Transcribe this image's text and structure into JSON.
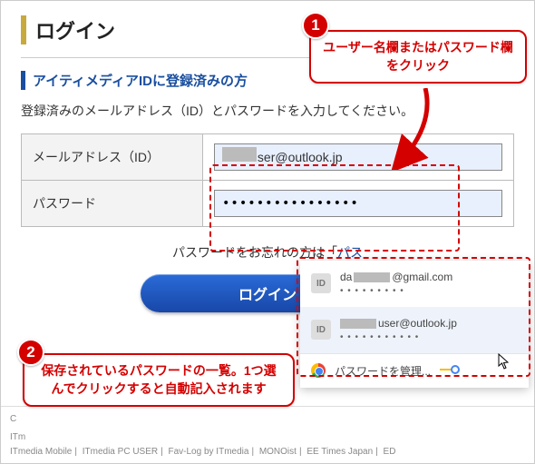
{
  "header": {
    "title": "ログイン",
    "subtitle": "アイティメディアIDに登録済みの方",
    "instruction": "登録済みのメールアドレス（ID）とパスワードを入力してください。"
  },
  "form": {
    "email_label": "メールアドレス（ID）",
    "email_value": "        user@outlook.jp",
    "password_label": "パスワード",
    "password_value": "••••••••••••••••"
  },
  "forgot": {
    "prefix": "パスワードをお忘れの方は「",
    "link": "パス"
  },
  "login_button": "ログイン",
  "autofill": {
    "items": [
      {
        "prefix": "da",
        "suffix": "@gmail.com",
        "dots": "• • • • • • • • •"
      },
      {
        "prefix": "",
        "suffix": "user@outlook.jp",
        "dots": "• • • • • • • • • • •"
      }
    ],
    "manage_label": "パスワードを管理..."
  },
  "callouts": {
    "c1": "ユーザー名欄またはパスワード欄をクリック",
    "c2": "保存されているパスワードの一覧。1つ選んでクリックすると自動記入されます",
    "n1": "1",
    "n2": "2"
  },
  "footer": {
    "copy": "C",
    "links": [
      "ITm",
      "ITmedia Mobile",
      "ITmedia PC USER",
      "Fav-Log by ITmedia",
      "MONOist",
      "EE Times Japan",
      "ED"
    ]
  }
}
